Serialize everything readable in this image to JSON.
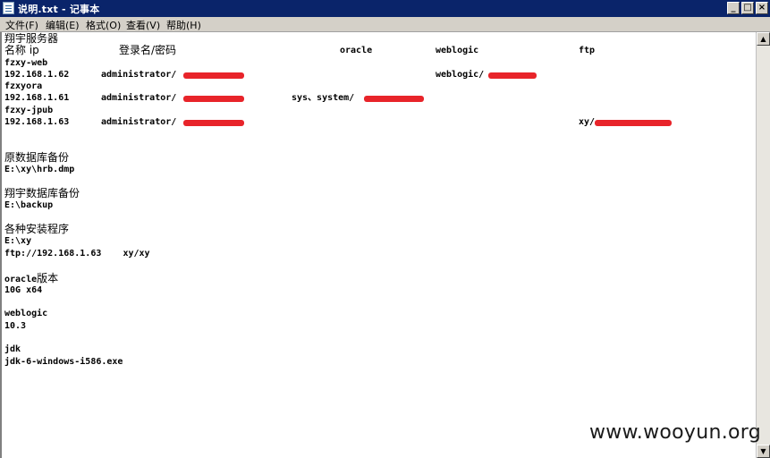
{
  "window": {
    "title": "说明.txt - 记事本",
    "minimize": "_",
    "maximize": "□",
    "close": "×"
  },
  "menu": [
    "文件(F)",
    "编辑(E)",
    "格式(O)",
    "查看(V)",
    "帮助(H)"
  ],
  "doc": {
    "l1": "翔宇服务器",
    "h_name": "名称 ip",
    "h_login": "登录名/密码",
    "h_oracle": "oracle",
    "h_weblogic": "weblogic",
    "h_ftp": "ftp",
    "s1_name": "fzxy-web",
    "s1_ip": "192.168.1.62",
    "s1_user": "administrator/",
    "s1_weblogic": "weblogic/",
    "s2_name": "fzxyora",
    "s2_ip": "192.168.1.61",
    "s2_user": "administrator/",
    "s2_oracle": "sys、system/",
    "s3_name": "fzxy-jpub",
    "s3_ip": "192.168.1.63",
    "s3_user": "administrator/",
    "s3_ftp": "xy/",
    "b1_title": "原数据库备份",
    "b1_path": "E:\\xy\\hrb.dmp",
    "b2_title": "翔宇数据库备份",
    "b2_path": "E:\\backup",
    "i_title": "各种安装程序",
    "i_path": "E:\\xy",
    "i_ftp": "ftp://192.168.1.63    xy/xy",
    "o_title_a": "oracle",
    "o_title_b": "版本",
    "o_ver": "10G x64",
    "w_title": "weblogic",
    "w_ver": "10.3",
    "j_title": "jdk",
    "j_file": "jdk-6-windows-i586.exe"
  },
  "watermark": "www.wooyun.org",
  "colors": {
    "titlebar": "#0a246a",
    "redaction": "#e8242a"
  }
}
